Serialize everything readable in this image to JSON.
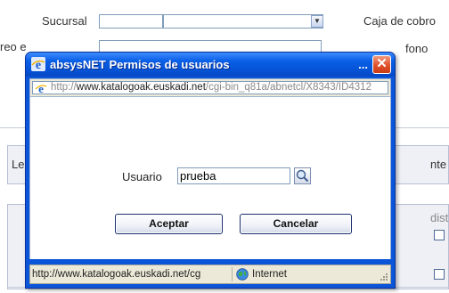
{
  "background": {
    "sucursal_label": "Sucursal",
    "caja_label": "Caja de cobro",
    "correo_label": "reo e",
    "telefono_label": "fono",
    "left_fragment": "Le",
    "right_fragment": "nte",
    "dist_fragment": "dist"
  },
  "dialog": {
    "title": "absysNET Permisos de usuarios",
    "title_dots": "...",
    "close_glyph": "✕",
    "address": {
      "scheme": "http://",
      "host": "www.katalogoak.euskadi.net",
      "path": "/cgi-bin_q81a/abnetcl/X8343/ID4312"
    },
    "form": {
      "user_label": "Usuario",
      "user_value": "prueba",
      "accept_label": "Aceptar",
      "cancel_label": "Cancelar"
    },
    "status": {
      "url": "http://www.katalogoak.euskadi.net/cg",
      "zone": "Internet"
    }
  },
  "colors": {
    "titlebar": "#0a5fe6",
    "close": "#e0502a",
    "chrome": "#ece9d8"
  }
}
